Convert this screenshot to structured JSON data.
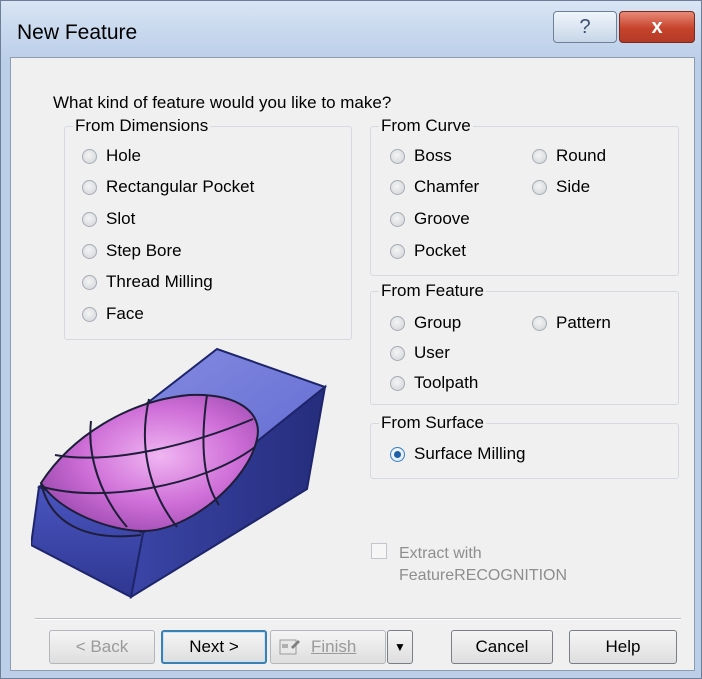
{
  "window": {
    "title": "New Feature",
    "help_glyph": "?",
    "close_glyph": "x"
  },
  "question": "What kind of feature would you like to make?",
  "from_dimensions": {
    "label": "From Dimensions",
    "options": [
      "Hole",
      "Rectangular Pocket",
      "Slot",
      "Step Bore",
      "Thread Milling",
      "Face"
    ]
  },
  "from_curve": {
    "label": "From Curve",
    "options": [
      "Boss",
      "Round",
      "Chamfer",
      "Side",
      "Groove",
      "Pocket"
    ]
  },
  "from_feature": {
    "label": "From Feature",
    "options": [
      "Group",
      "Pattern",
      "User",
      "Toolpath"
    ]
  },
  "from_surface": {
    "label": "From Surface",
    "options": [
      "Surface Milling"
    ],
    "selected": "Surface Milling"
  },
  "extract": {
    "line1": "Extract with",
    "line2": "FeatureRECOGNITION",
    "checked": false,
    "enabled": false
  },
  "buttons": {
    "back": "< Back",
    "next": "Next >",
    "finish": "Finish",
    "cancel": "Cancel",
    "help": "Help"
  },
  "colors": {
    "block": "#5563c9",
    "surface": "#c86ad6",
    "selected_radio": "#1f5fa8"
  }
}
